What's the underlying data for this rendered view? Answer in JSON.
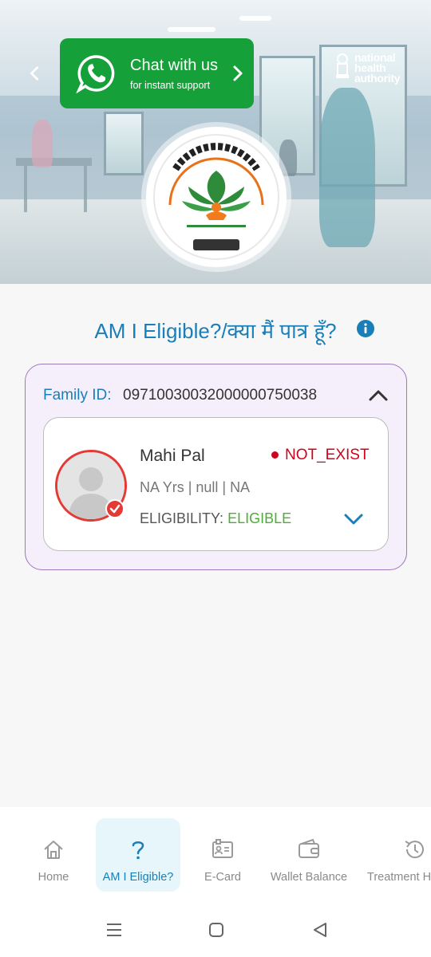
{
  "banner": {
    "chat_title": "Chat with us",
    "chat_subtitle": "for instant support",
    "nha_lines": [
      "national",
      "health",
      "authority"
    ]
  },
  "main": {
    "title": "AM I Eligible?/क्या मैं पात्र हूँ?",
    "family_label": "Family ID:",
    "family_id": "09710030032000000750038",
    "member": {
      "name": "Mahi Pal",
      "status": "NOT_EXIST",
      "meta": "NA Yrs | null | NA",
      "eligibility_label": "ELIGIBILITY:",
      "eligibility_value": "ELIGIBLE"
    }
  },
  "bottom_nav": [
    {
      "label": "Home",
      "icon": "home-icon"
    },
    {
      "label": "AM I Eligible?",
      "icon": "question-icon",
      "active": true
    },
    {
      "label": "E-Card",
      "icon": "id-card-icon"
    },
    {
      "label": "Wallet Balance",
      "icon": "wallet-icon"
    },
    {
      "label": "Treatment H",
      "icon": "history-icon"
    }
  ],
  "colors": {
    "accent": "#1a7fb8",
    "whatsapp_green": "#16a03a",
    "status_red": "#d0021b",
    "eligible_green": "#4caf35",
    "card_border": "#9c7ab8"
  }
}
